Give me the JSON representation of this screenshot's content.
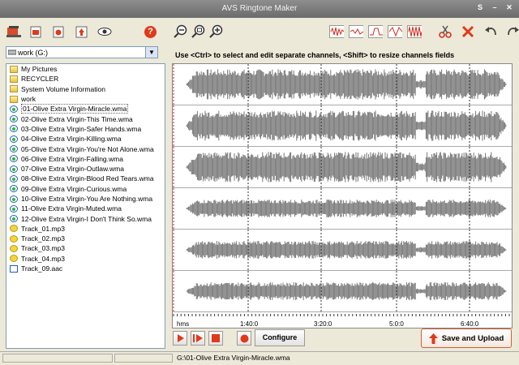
{
  "window": {
    "title": "AVS Ringtone Maker"
  },
  "toolbar": {
    "left_icons": [
      "load-icon",
      "new-file-icon",
      "favorites-icon",
      "upload-icon",
      "preview-eye-icon"
    ],
    "help_label": "?",
    "zoom_icons": [
      "zoom-out-icon",
      "zoom-fit-icon",
      "zoom-in-icon"
    ],
    "effect_icons": [
      "effect-1-icon",
      "effect-2-icon",
      "effect-3-icon",
      "effect-4-icon",
      "effect-5-icon"
    ],
    "cut_icon": "scissors-icon",
    "delete_icon": "delete-icon",
    "undo_icon": "undo-icon",
    "redo_icon": "redo-icon"
  },
  "drive": {
    "label": "work (G:)"
  },
  "hint": "Use <Ctrl> to select and edit separate channels, <Shift> to resize channels fields",
  "files": [
    {
      "name": "My Pictures",
      "type": "folder"
    },
    {
      "name": "RECYCLER",
      "type": "folder"
    },
    {
      "name": "System Volume Information",
      "type": "folder"
    },
    {
      "name": "work",
      "type": "folder"
    },
    {
      "name": "01-Olive Extra Virgin-Miracle.wma",
      "type": "wma",
      "selected": true
    },
    {
      "name": "02-Olive Extra Virgin-This Time.wma",
      "type": "wma"
    },
    {
      "name": "03-Olive Extra Virgin-Safer Hands.wma",
      "type": "wma"
    },
    {
      "name": "04-Olive Extra Virgin-Killing.wma",
      "type": "wma"
    },
    {
      "name": "05-Olive Extra Virgin-You're Not Alone.wma",
      "type": "wma"
    },
    {
      "name": "06-Olive Extra Virgin-Falling.wma",
      "type": "wma"
    },
    {
      "name": "07-Olive Extra Virgin-Outlaw.wma",
      "type": "wma"
    },
    {
      "name": "08-Olive Extra Virgin-Blood Red Tears.wma",
      "type": "wma"
    },
    {
      "name": "09-Olive Extra Virgin-Curious.wma",
      "type": "wma"
    },
    {
      "name": "10-Olive Extra Virgin-You Are Nothing.wma",
      "type": "wma"
    },
    {
      "name": "11-Olive Extra Virgin-Muted.wma",
      "type": "wma"
    },
    {
      "name": "12-Olive Extra Virgin-I Don't Think So.wma",
      "type": "wma"
    },
    {
      "name": "Track_01.mp3",
      "type": "mp3"
    },
    {
      "name": "Track_02.mp3",
      "type": "mp3"
    },
    {
      "name": "Track_03.mp3",
      "type": "mp3"
    },
    {
      "name": "Track_04.mp3",
      "type": "mp3"
    },
    {
      "name": "Track_09.aac",
      "type": "aac"
    }
  ],
  "timeline": {
    "unit_label": "hms",
    "ticks": [
      "1:40:0",
      "3:20:0",
      "5:0:0",
      "6:40:0"
    ]
  },
  "controls": {
    "play_icon": "play-icon",
    "play_selection_icon": "play-selection-icon",
    "stop_icon": "stop-icon",
    "record_icon": "record-icon",
    "configure_label": "Configure",
    "save_label": "Save and Upload"
  },
  "status": {
    "path": "G:\\01-Olive Extra Virgin-Miracle.wma"
  },
  "colors": {
    "wave": "#777777",
    "accent": "#e03a1a",
    "selection": "#cc2222"
  }
}
